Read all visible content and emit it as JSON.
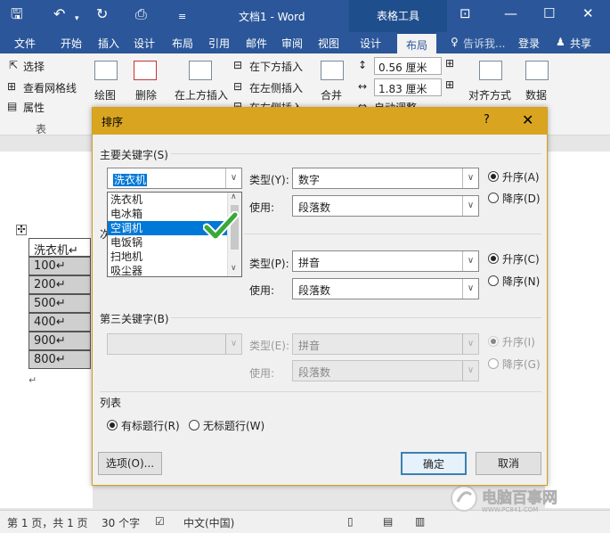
{
  "titlebar": {
    "doc_title": "文档1 - Word",
    "context_tools": "表格工具"
  },
  "tabs": {
    "items": [
      "文件",
      "开始",
      "插入",
      "设计",
      "布局",
      "引用",
      "邮件",
      "审阅",
      "视图",
      "设计",
      "布局"
    ],
    "tell_me": "告诉我...",
    "login": "登录",
    "share": "共享"
  },
  "ribbon": {
    "select": "选择",
    "view_grid": "查看网格线",
    "properties": "属性",
    "group_table": "表",
    "draw": "绘图",
    "delete": "删除",
    "insert_above": "在上方插入",
    "insert_below": "在下方插入",
    "insert_left": "在左侧插入",
    "insert_right": "在右侧插入",
    "merge": "合并",
    "height_value": "0.56 厘米",
    "width_value": "1.83 厘米",
    "auto_adjust": "自动调整",
    "align": "对齐方式",
    "data": "数据"
  },
  "table": {
    "header": "洗衣机↵",
    "rows": [
      "100↵",
      "200↵",
      "500↵",
      "400↵",
      "900↵",
      "800↵"
    ]
  },
  "statusbar": {
    "page": "第 1 页，共 1 页",
    "words": "30 个字",
    "lang": "中文(中国)"
  },
  "dialog": {
    "title": "排序",
    "help": "?",
    "key1": {
      "label": "主要关键字(S)",
      "value": "洗衣机",
      "type_label": "类型(Y):",
      "type_value": "数字",
      "use_label": "使用:",
      "use_value": "段落数",
      "asc": "升序(A)",
      "desc": "降序(D)"
    },
    "dropdown_options": [
      "洗衣机",
      "电冰箱",
      "空调机",
      "电饭锅",
      "扫地机",
      "吸尘器"
    ],
    "dropdown_selected": "空调机",
    "key2": {
      "label_partial": "次",
      "type_label": "类型(P):",
      "type_value": "拼音",
      "use_label": "使用:",
      "use_value": "段落数",
      "asc": "升序(C)",
      "desc": "降序(N)"
    },
    "key3": {
      "label": "第三关键字(B)",
      "type_label": "类型(E):",
      "type_value": "拼音",
      "use_label": "使用:",
      "use_value": "段落数",
      "asc": "升序(I)",
      "desc": "降序(G)"
    },
    "list": {
      "label": "列表",
      "with_header": "有标题行(R)",
      "without_header": "无标题行(W)"
    },
    "options_button": "选项(O)...",
    "ok_button": "确定",
    "cancel_button": "取消"
  },
  "watermark": {
    "name": "电脑百事网",
    "url": "WWW.PC841.COM"
  },
  "colors": {
    "word_blue": "#2b579a",
    "dialog_title": "#d9a521",
    "selection": "#0078d7",
    "check_green": "#3aa83a"
  }
}
